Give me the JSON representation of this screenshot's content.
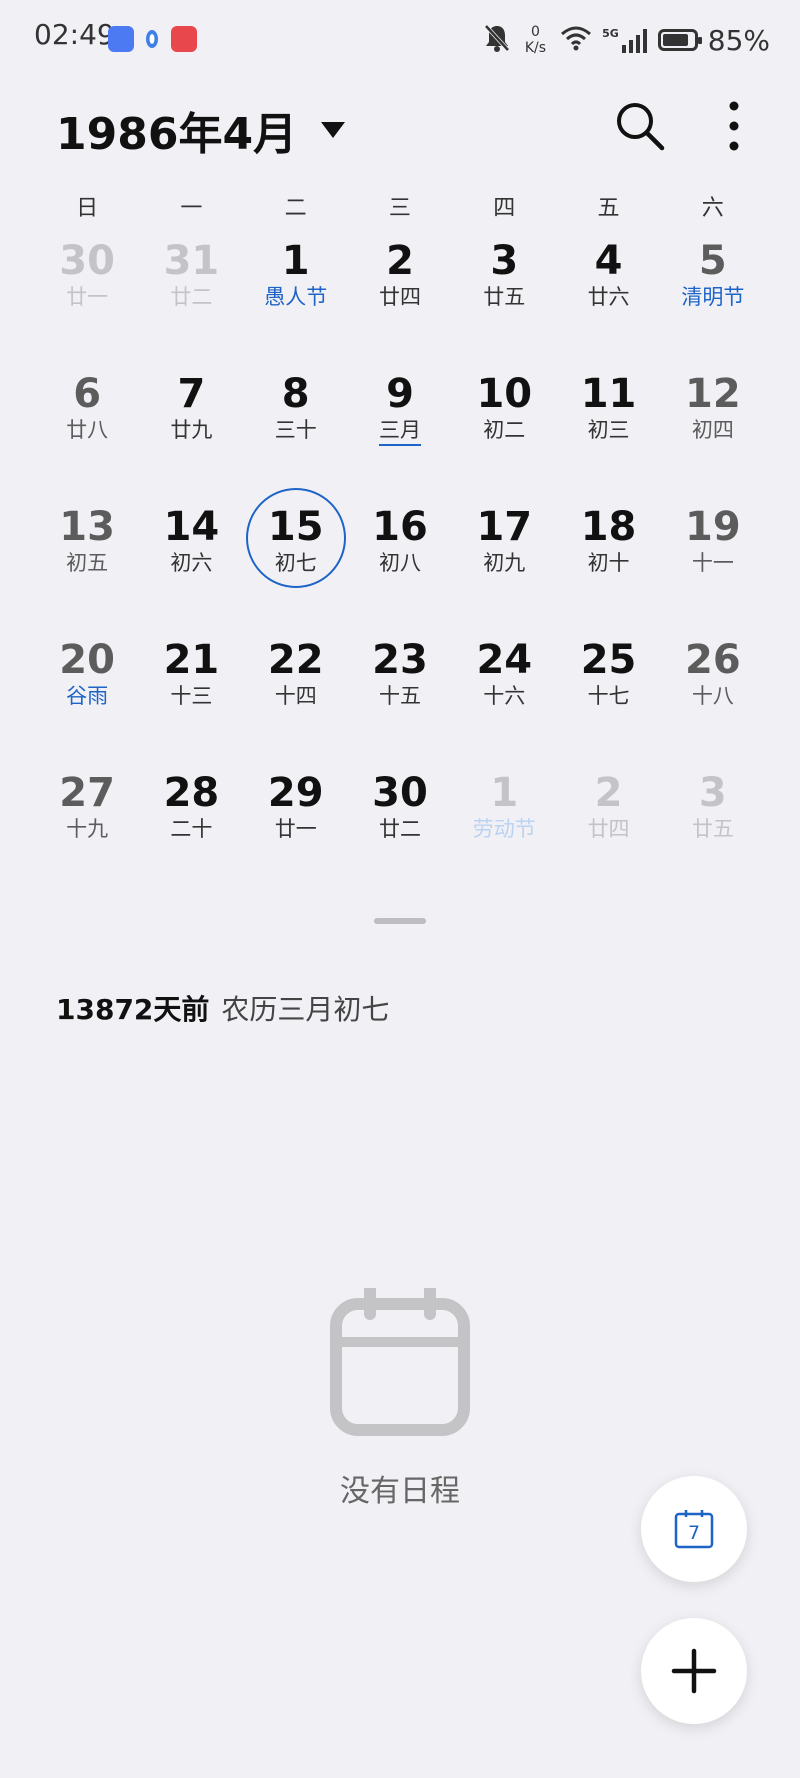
{
  "status_bar": {
    "time": "02:49",
    "net_speed_value": "0",
    "net_speed_unit": "K/s",
    "network_label": "5G",
    "battery_percent": 85,
    "battery_text": "85%",
    "icons": [
      "bell-off-icon",
      "wifi-icon",
      "signal-icon",
      "battery-icon"
    ]
  },
  "header": {
    "title": "1986年4月"
  },
  "weekdays": [
    "日",
    "一",
    "二",
    "三",
    "四",
    "五",
    "六"
  ],
  "weeks": [
    [
      {
        "num": "30",
        "sub": "廿一",
        "other": true,
        "weekend": true
      },
      {
        "num": "31",
        "sub": "廿二",
        "other": true
      },
      {
        "num": "1",
        "sub": "愚人节",
        "holiday": true
      },
      {
        "num": "2",
        "sub": "廿四"
      },
      {
        "num": "3",
        "sub": "廿五"
      },
      {
        "num": "4",
        "sub": "廿六"
      },
      {
        "num": "5",
        "sub": "清明节",
        "holiday": true,
        "weekend": true
      }
    ],
    [
      {
        "num": "6",
        "sub": "廿八",
        "weekend": true
      },
      {
        "num": "7",
        "sub": "廿九"
      },
      {
        "num": "8",
        "sub": "三十"
      },
      {
        "num": "9",
        "sub": "三月",
        "lunar_first": true
      },
      {
        "num": "10",
        "sub": "初二"
      },
      {
        "num": "11",
        "sub": "初三"
      },
      {
        "num": "12",
        "sub": "初四",
        "weekend": true
      }
    ],
    [
      {
        "num": "13",
        "sub": "初五",
        "weekend": true
      },
      {
        "num": "14",
        "sub": "初六"
      },
      {
        "num": "15",
        "sub": "初七",
        "selected": true
      },
      {
        "num": "16",
        "sub": "初八"
      },
      {
        "num": "17",
        "sub": "初九"
      },
      {
        "num": "18",
        "sub": "初十"
      },
      {
        "num": "19",
        "sub": "十一",
        "weekend": true
      }
    ],
    [
      {
        "num": "20",
        "sub": "谷雨",
        "holiday": true,
        "weekend": true
      },
      {
        "num": "21",
        "sub": "十三"
      },
      {
        "num": "22",
        "sub": "十四"
      },
      {
        "num": "23",
        "sub": "十五"
      },
      {
        "num": "24",
        "sub": "十六"
      },
      {
        "num": "25",
        "sub": "十七"
      },
      {
        "num": "26",
        "sub": "十八",
        "weekend": true
      }
    ],
    [
      {
        "num": "27",
        "sub": "十九",
        "weekend": true
      },
      {
        "num": "28",
        "sub": "二十"
      },
      {
        "num": "29",
        "sub": "廿一"
      },
      {
        "num": "30",
        "sub": "廿二"
      },
      {
        "num": "1",
        "sub": "劳动节",
        "other": true,
        "holiday": true
      },
      {
        "num": "2",
        "sub": "廿四",
        "other": true
      },
      {
        "num": "3",
        "sub": "廿五",
        "other": true,
        "weekend": true
      }
    ]
  ],
  "info": {
    "days_ago": "13872天前",
    "lunar_date": "农历三月初七"
  },
  "empty_state": {
    "text": "没有日程"
  },
  "fab": {
    "today_day": "7"
  },
  "colors": {
    "accent": "#1e63c6",
    "background": "#f1f1f5",
    "muted": "#c4c4c8"
  }
}
